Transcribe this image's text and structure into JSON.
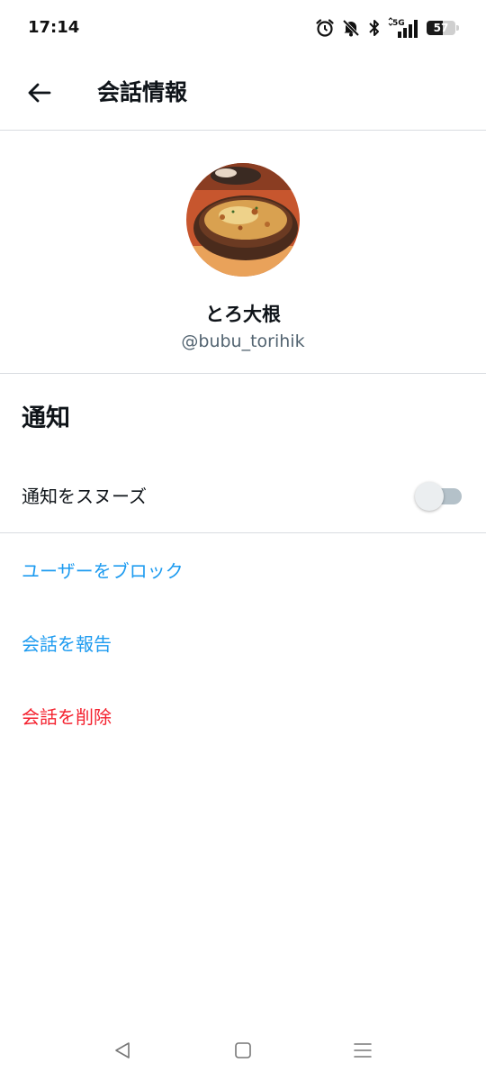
{
  "status_bar": {
    "time": "17:14",
    "network": "5G",
    "battery": "57",
    "battery_level_percent": 57,
    "icons": [
      "alarm-icon",
      "mute-notifications-icon",
      "bluetooth-icon",
      "signal-5g-icon",
      "battery-icon"
    ]
  },
  "header": {
    "back_icon": "arrow-left-icon",
    "title": "会話情報"
  },
  "profile": {
    "avatar": "food-photo-avatar",
    "name": "とろ大根",
    "handle": "@bubu_torihik"
  },
  "notifications": {
    "heading": "通知",
    "snooze_label": "通知をスヌーズ",
    "snooze_on": false
  },
  "actions": {
    "block_user": "ユーザーをブロック",
    "report_conversation": "会話を報告",
    "delete_conversation": "会話を削除"
  },
  "colors": {
    "link_blue": "#1d9bf0",
    "danger_red": "#f4212e",
    "handle_gray": "#536471",
    "divider": "#d9dce1"
  },
  "nav_bar": {
    "icons": [
      "back-triangle-icon",
      "home-square-icon",
      "recents-menu-icon"
    ]
  }
}
